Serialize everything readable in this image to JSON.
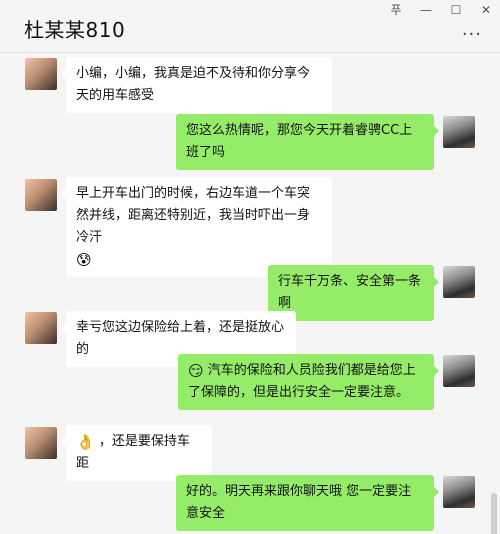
{
  "window": {
    "title": "杜某某810",
    "controls": {
      "pin": "푸",
      "minimize": "—",
      "maximize": "☐",
      "close": "✕"
    },
    "more_icon": "···"
  },
  "messages": [
    {
      "side": "in",
      "text": "小编，小编，我真是迫不及待和你分享今天的用车感受"
    },
    {
      "side": "out",
      "text": "您这么热情呢，那您今天开着睿骋CC上班了吗"
    },
    {
      "side": "in",
      "text": "早上开车出门的时候，右边车道一个车突然并线，距离还特别近，我当时吓出一身冷汗",
      "emoji": "😰"
    },
    {
      "side": "out",
      "text": "行车千万条、安全第一条啊"
    },
    {
      "side": "in",
      "text": "幸亏您这边保险给上着，还是挺放心的"
    },
    {
      "side": "out",
      "emoji": "😏",
      "text": "汽车的保险和人员险我们都是给您上了保障的，但是出行安全一定要注意。"
    },
    {
      "side": "in",
      "emoji": "👌",
      "text": "，还是要保持车距"
    },
    {
      "side": "out",
      "text": "好的。明天再来跟你聊天哦 您一定要注意安全"
    }
  ]
}
